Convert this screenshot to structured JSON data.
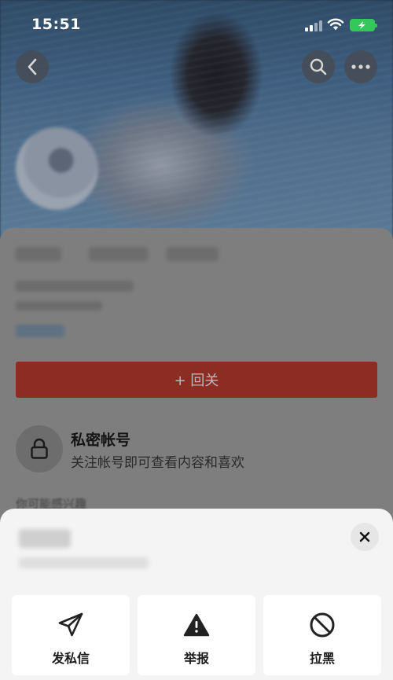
{
  "status_bar": {
    "time": "15:51"
  },
  "profile": {
    "follow_back_label": "+ 回关",
    "private_title": "私密帐号",
    "private_desc": "关注帐号即可查看内容和喜欢",
    "maybe_know": "你可能感兴趣"
  },
  "sheet": {
    "actions": [
      {
        "label": "发私信",
        "icon": "send-icon"
      },
      {
        "label": "举报",
        "icon": "warning-icon"
      },
      {
        "label": "拉黑",
        "icon": "block-icon"
      }
    ]
  },
  "colors": {
    "follow_button": "#8d2c22",
    "sheet_bg": "#f4f4f4",
    "battery": "#34c759"
  }
}
